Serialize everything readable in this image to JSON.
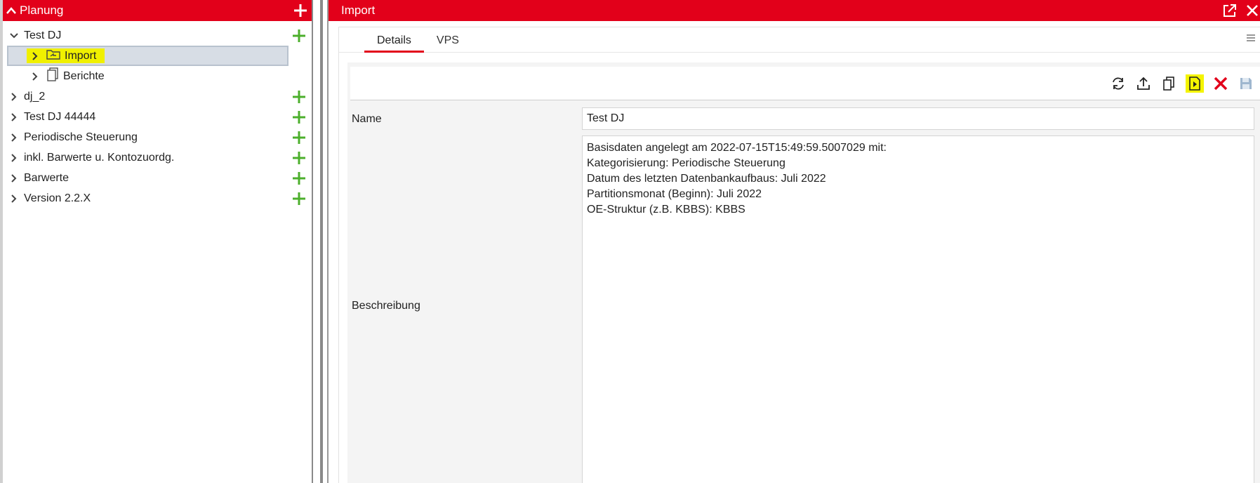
{
  "left": {
    "header_title": "Planung",
    "tree": [
      {
        "label": "Test DJ",
        "expanded": true
      },
      {
        "label": "Import",
        "child": true,
        "selected": true
      },
      {
        "label": "Berichte",
        "child": true
      },
      {
        "label": "dj_2"
      },
      {
        "label": "Test DJ 44444"
      },
      {
        "label": "Periodische Steuerung"
      },
      {
        "label": "inkl. Barwerte u. Kontozuordg."
      },
      {
        "label": "Barwerte"
      },
      {
        "label": "Version 2.2.X"
      }
    ]
  },
  "right": {
    "header_title": "Import",
    "tabs": [
      {
        "label": "Details",
        "active": true
      },
      {
        "label": "VPS",
        "active": false
      }
    ],
    "toolbar": [
      "refresh-icon",
      "upload-icon",
      "copy-icon",
      "run-icon",
      "delete-icon",
      "save-icon"
    ],
    "form": {
      "name_label": "Name",
      "name_value": "Test DJ",
      "description_label": "Beschreibung",
      "description_lines": [
        "Basisdaten angelegt am 2022-07-15T15:49:59.5007029 mit:",
        "Kategorisierung: Periodische Steuerung",
        "Datum des letzten Datenbankaufbaus: Juli 2022",
        "Partitionsmonat (Beginn): Juli 2022",
        "OE-Struktur (z.B. KBBS): KBBS"
      ]
    }
  },
  "colors": {
    "brand_red": "#e2001a",
    "add_green": "#4caf2c",
    "highlight_yellow": "#f0f000",
    "selected_bg": "#d7dde5"
  }
}
